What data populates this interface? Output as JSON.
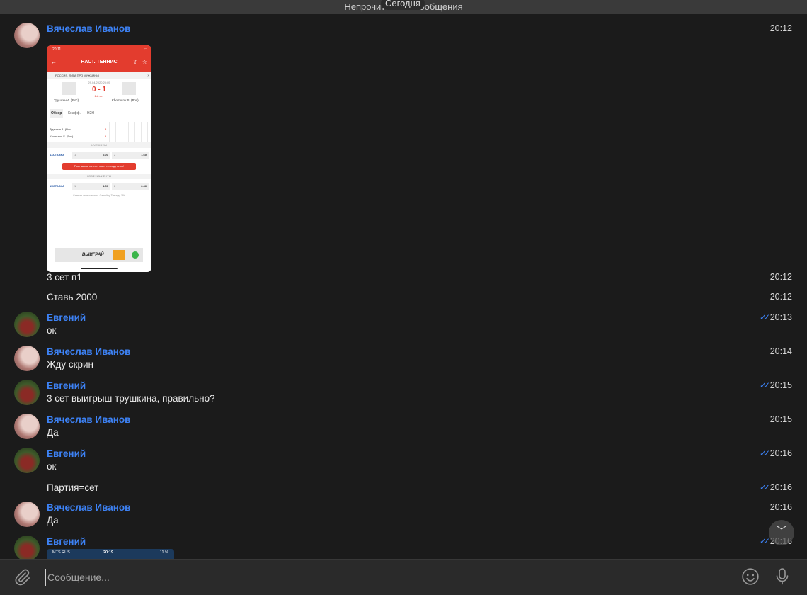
{
  "topbar": {
    "unread_label": "Непрочитанные сообщения",
    "date_label": "Сегодня"
  },
  "messages": [
    {
      "sender": "Вячеслав Иванов",
      "time": "20:12"
    },
    {
      "text": "3 сет п1",
      "time": "20:12"
    },
    {
      "text": "Ставь 2000",
      "time": "20:12"
    },
    {
      "sender": "Евгений",
      "text": "ок",
      "time": "20:13",
      "read": "✓✓"
    },
    {
      "sender": "Вячеслав Иванов",
      "text": "Жду скрин",
      "time": "20:14"
    },
    {
      "sender": "Евгений",
      "text": "3 сет выигрыш трушкина, правильно?",
      "time": "20:15",
      "read": "✓✓"
    },
    {
      "sender": "Вячеслав Иванов",
      "text": "Да",
      "time": "20:15"
    },
    {
      "sender": "Евгений",
      "text": "ок",
      "time": "20:16",
      "read": "✓✓"
    },
    {
      "text": "Партия=сет",
      "time": "20:16",
      "read": "✓✓"
    },
    {
      "sender": "Вячеслав Иванов",
      "text": "Да",
      "time": "20:16"
    },
    {
      "sender": "Евгений",
      "time": "20:16",
      "read": "✓✓"
    }
  ],
  "screenshot1": {
    "status_time": "20:11",
    "header_title": "НАСТ. ТЕННИС",
    "league": "РОССИЯ. ЛИГА ПРО МУЖЧИНЫ",
    "match_date": "29.04.2020 20:05",
    "score": "0 - 1",
    "set_label": "2-й сет",
    "player1": "Трушкин А. (Рос)",
    "player2": "Khomutov S. (Рос)",
    "tabs": [
      "Обзор",
      "Коэфф.",
      "H2H"
    ],
    "row1_name": "Трушкин А. (Рос)",
    "row1_score": "0",
    "row2_name": "Khomutov S. (Рос)",
    "row2_score": "1",
    "section_live": "LIVE КЭФЫ",
    "brand": "1XСТАВКА",
    "live_odd1": "2.01",
    "live_odd2": "1.60",
    "bet_button": "Поставили на этот матч по ходу игры!",
    "section_odds": "КОЭФФИЦИЕНТЫ",
    "odd1": "1.51",
    "odd2": "2.46",
    "footer": "Ставьте ответственно. Gambling Therapy. 18+",
    "banner": "ВЫИГРАЙ"
  },
  "screenshot2": {
    "carrier": "MTS RUS",
    "time": "20:19",
    "battery": "11 %"
  },
  "composer": {
    "placeholder": "Сообщение..."
  },
  "icons": {
    "attach": "paperclip-icon",
    "emoji": "emoji-icon",
    "mic": "microphone-icon",
    "scroll": "chevron-down-icon"
  },
  "colors": {
    "accent": "#3d82f5",
    "background": "#1b1b1b",
    "composer": "#2a2a2a"
  }
}
